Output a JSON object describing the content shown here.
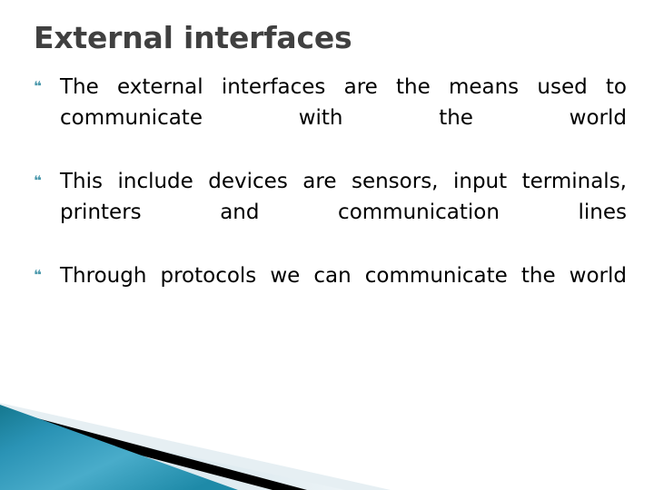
{
  "slide": {
    "title": "External interfaces",
    "bullet_marker_glyph": "❝",
    "bullets": [
      {
        "marker": "❝",
        "text": "The external interfaces are the means used to communicate with the world"
      },
      {
        "marker": "❝",
        "text": "This include devices are sensors, input terminals, printers and communication lines"
      },
      {
        "marker": "❝",
        "text": "Through protocols we can communicate the world"
      }
    ],
    "colors": {
      "title": "#404040",
      "body_text": "#000000",
      "bullet_marker": "#4e9aad",
      "background": "#ffffff",
      "accent_teal_dark": "#1b7e9e",
      "accent_teal_light": "#45a9c9",
      "accent_black": "#000000",
      "accent_pale_blue": "#dce8ee"
    },
    "decoration": {
      "name": "bottom-left-angled-banner",
      "shapes": [
        "teal-gradient-wedge",
        "black-diagonal-stripe",
        "pale-blue-diagonal-band"
      ]
    }
  }
}
